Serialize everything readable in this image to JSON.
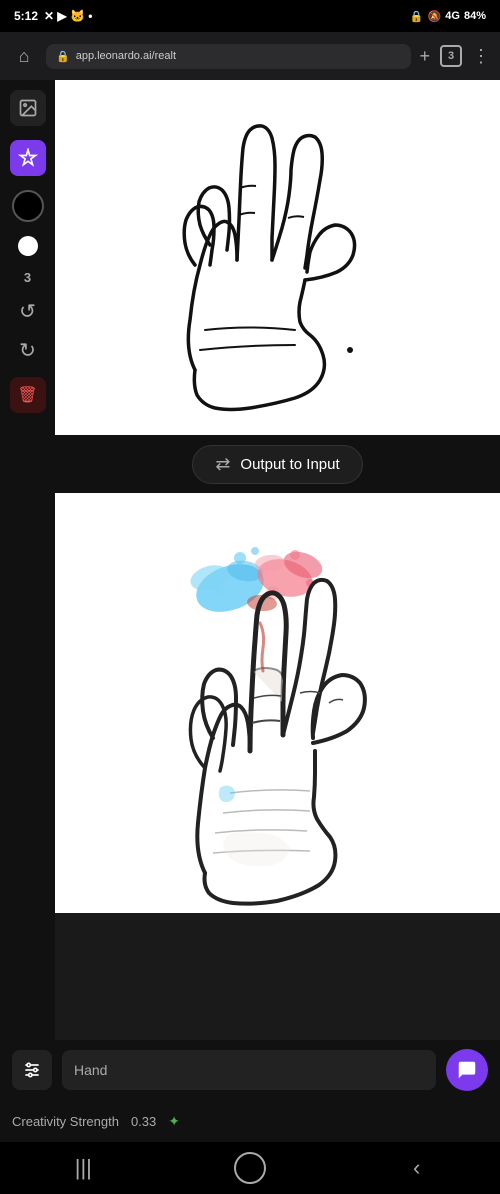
{
  "statusBar": {
    "time": "5:12",
    "icons": [
      "X",
      "▶",
      "🐱",
      "•"
    ],
    "rightIcons": [
      "🔒",
      "🔇",
      "4G",
      "84%"
    ]
  },
  "browserBar": {
    "url": "app.leonardo.ai/realt",
    "tabCount": "3"
  },
  "sidebar": {
    "tools": [
      "brush",
      "eraser",
      "color",
      "circle",
      "number3",
      "undo",
      "redo",
      "delete"
    ]
  },
  "outputToInput": {
    "label": "Output to Input",
    "swapSymbol": "⇄"
  },
  "bottomToolbar": {
    "settingsLabel": "⚙",
    "promptPlaceholder": "Hand",
    "chatLabel": "💬"
  },
  "creativity": {
    "label": "Creativity Strength",
    "value": "0.33"
  },
  "navBar": {
    "back": "◀",
    "home": "○",
    "recents": "|||"
  }
}
